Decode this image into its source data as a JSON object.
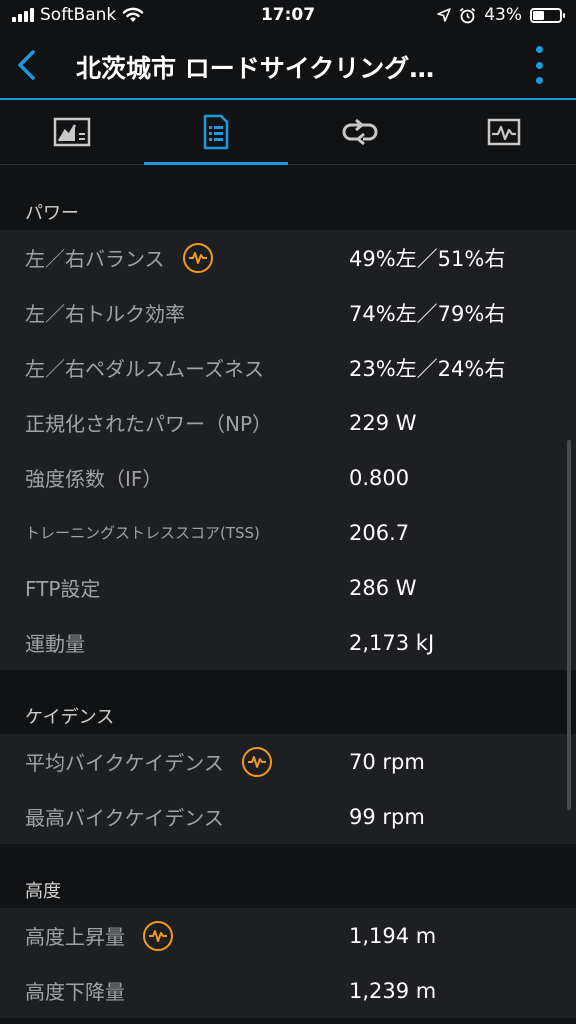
{
  "status": {
    "carrier": "SoftBank",
    "time": "17:07",
    "battery_percent": "43%",
    "battery_level": 0.43
  },
  "header": {
    "title": "北茨城市 ロードサイクリング…"
  },
  "tabs": [
    {
      "icon": "chart-icon",
      "active": false
    },
    {
      "icon": "list-document-icon",
      "active": true
    },
    {
      "icon": "repeat-laps-icon",
      "active": false
    },
    {
      "icon": "graph-icon",
      "active": false
    }
  ],
  "sections": {
    "power": {
      "title": "パワー",
      "rows": [
        {
          "label": "左／右バランス",
          "value": "49%左／51%右",
          "has_badge": true
        },
        {
          "label": "左／右トルク効率",
          "value": "74%左／79%右"
        },
        {
          "label": "左／右ペダルスムーズネス",
          "value": "23%左／24%右"
        },
        {
          "label": "正規化されたパワー（NP）",
          "value": "229 W"
        },
        {
          "label": "強度係数（IF）",
          "value": "0.800"
        },
        {
          "label": "トレーニングストレススコア(TSS)",
          "value": "206.7"
        },
        {
          "label": "FTP設定",
          "value": "286 W"
        },
        {
          "label": "運動量",
          "value": "2,173 kJ"
        }
      ]
    },
    "cadence": {
      "title": "ケイデンス",
      "rows": [
        {
          "label": "平均バイクケイデンス",
          "value": "70 rpm",
          "has_badge": true
        },
        {
          "label": "最高バイクケイデンス",
          "value": "99 rpm"
        }
      ]
    },
    "elevation": {
      "title": "高度",
      "rows": [
        {
          "label": "高度上昇量",
          "value": "1,194 m",
          "has_badge": true
        },
        {
          "label": "高度下降量",
          "value": "1,239 m"
        }
      ]
    }
  },
  "colors": {
    "accent": "#1a9be0",
    "badge": "#f29a1d",
    "background": "#111214",
    "row_background": "#1e1f22",
    "label": "#a0a2a6"
  }
}
